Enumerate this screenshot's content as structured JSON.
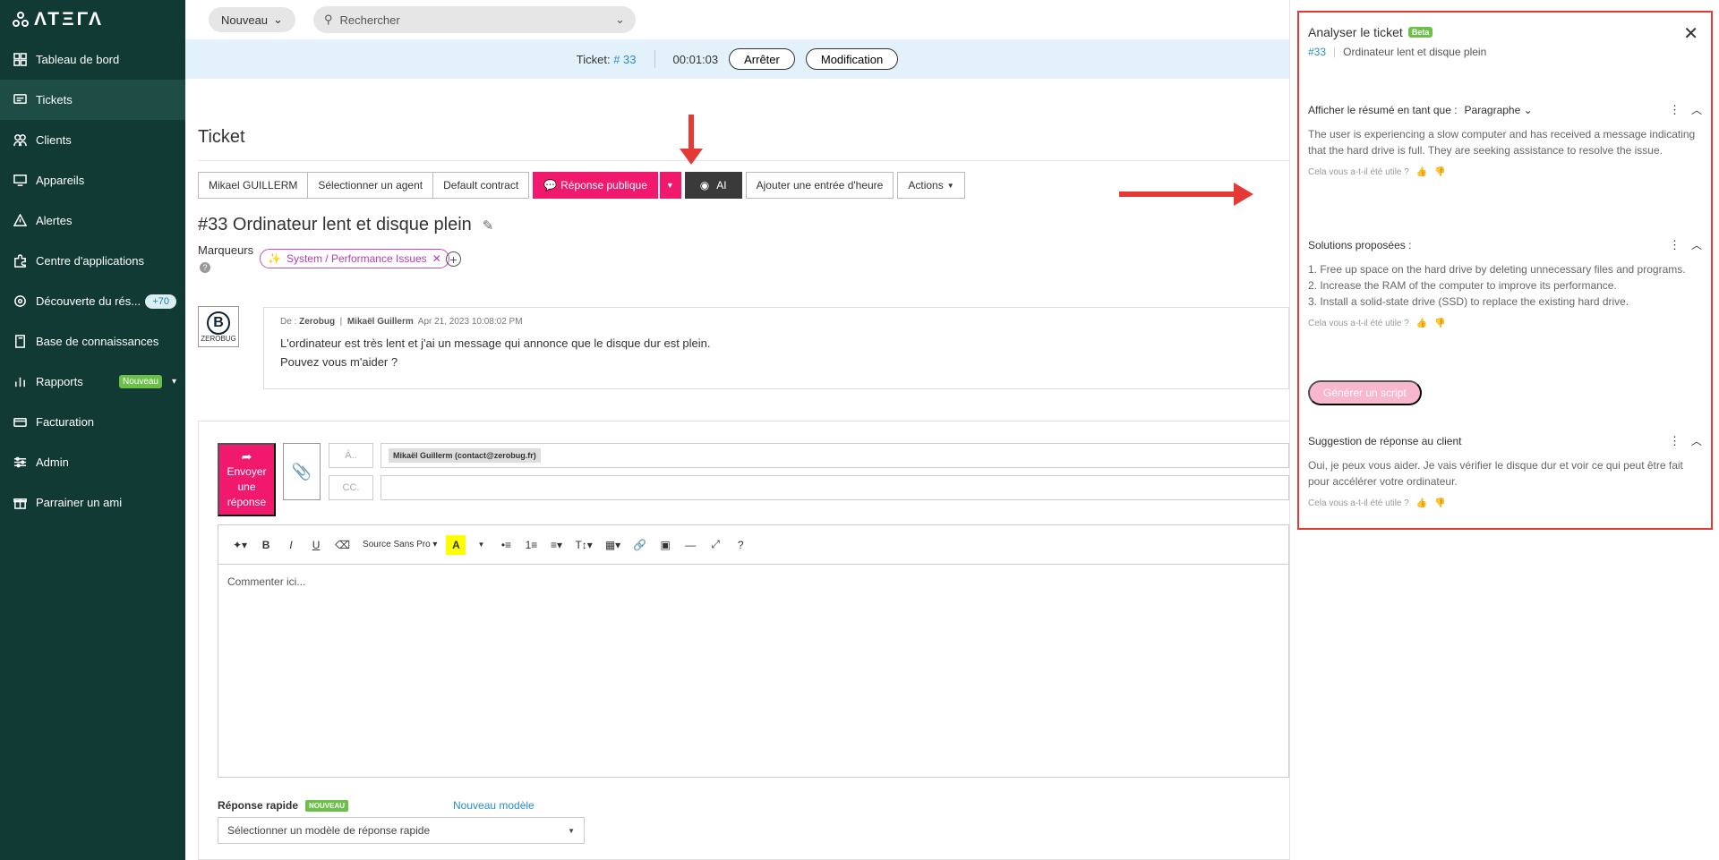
{
  "app": {
    "logo_text": "ΛΤΞΓΛ"
  },
  "sidebar": {
    "items": [
      {
        "label": "Tableau de bord"
      },
      {
        "label": "Tickets"
      },
      {
        "label": "Clients"
      },
      {
        "label": "Appareils"
      },
      {
        "label": "Alertes"
      },
      {
        "label": "Centre d'applications"
      },
      {
        "label": "Découverte du rés...",
        "badge": "+70"
      },
      {
        "label": "Base de connaissances"
      },
      {
        "label": "Rapports",
        "badge": "Nouveau"
      },
      {
        "label": "Facturation"
      },
      {
        "label": "Admin"
      },
      {
        "label": "Parrainer un ami"
      }
    ]
  },
  "topbar": {
    "new_label": "Nouveau",
    "search_placeholder": "Rechercher"
  },
  "ticketbar": {
    "ticket_label": "Ticket:",
    "ticket_link": "# 33",
    "timer": "00:01:03",
    "stop_label": "Arrêter",
    "edit_label": "Modification"
  },
  "main": {
    "page_title": "Ticket",
    "actions": {
      "assignee": "Mikael GUILLERM",
      "agent": "Sélectionner un agent",
      "contract": "Default contract",
      "public_reply": "Réponse publique",
      "ai": "AI",
      "time_entry": "Ajouter une entrée d'heure",
      "actions": "Actions"
    },
    "ticket_title": "#33 Ordinateur lent et disque plein",
    "markers_label": "Marqueurs",
    "marker_chip": "System / Performance Issues",
    "message": {
      "from_label": "De :",
      "from": "Zerobug",
      "author": "Mikaël Guillerm",
      "date": "Apr 21, 2023 10:08:02 PM",
      "line1": "L'ordinateur est très lent et j'ai un message qui annonce que le disque dur est plein.",
      "line2": "Pouvez vous m'aider ?",
      "avatar_text": "ZEROBUG"
    },
    "composer": {
      "send_label": "Envoyer une réponse",
      "to_label": "À..",
      "cc_label": "CC.",
      "recipient": "Mikaël Guillerm (contact@zerobug.fr)",
      "font_name": "Source Sans Pro",
      "placeholder": "Commenter ici...",
      "quick_reply_label": "Réponse rapide",
      "quick_reply_tag": "NOUVEAU",
      "new_template": "Nouveau modèle",
      "quick_reply_select": "Sélectionner un modèle de réponse rapide"
    }
  },
  "panel": {
    "title": "Analyser le ticket",
    "beta": "Beta",
    "ticket_link": "#33",
    "ticket_name": "Ordinateur lent et disque plein",
    "summary": {
      "heading": "Afficher le résumé en tant que :",
      "mode": "Paragraphe",
      "text": "The user is experiencing a slow computer and has received a message indicating that the hard drive is full. They are seeking assistance to resolve the issue."
    },
    "solutions": {
      "heading": "Solutions proposées :",
      "items": [
        "1. Free up space on the hard drive by deleting unnecessary files and programs.",
        "2. Increase the RAM of the computer to improve its performance.",
        "3. Install a solid-state drive (SSD) to replace the existing hard drive."
      ]
    },
    "generate_script": "Générer un script",
    "suggestion": {
      "heading": "Suggestion de réponse au client",
      "text": "Oui, je peux vous aider. Je vais vérifier le disque dur et voir ce qui peut être fait pour accélérer votre ordinateur."
    },
    "feedback": "Cela vous a-t-il été utile ?"
  },
  "colors": {
    "sidebar": "#103a33",
    "accent_pink": "#f0196e",
    "link_blue": "#2a8ccb",
    "annotation_red": "#e53935"
  }
}
